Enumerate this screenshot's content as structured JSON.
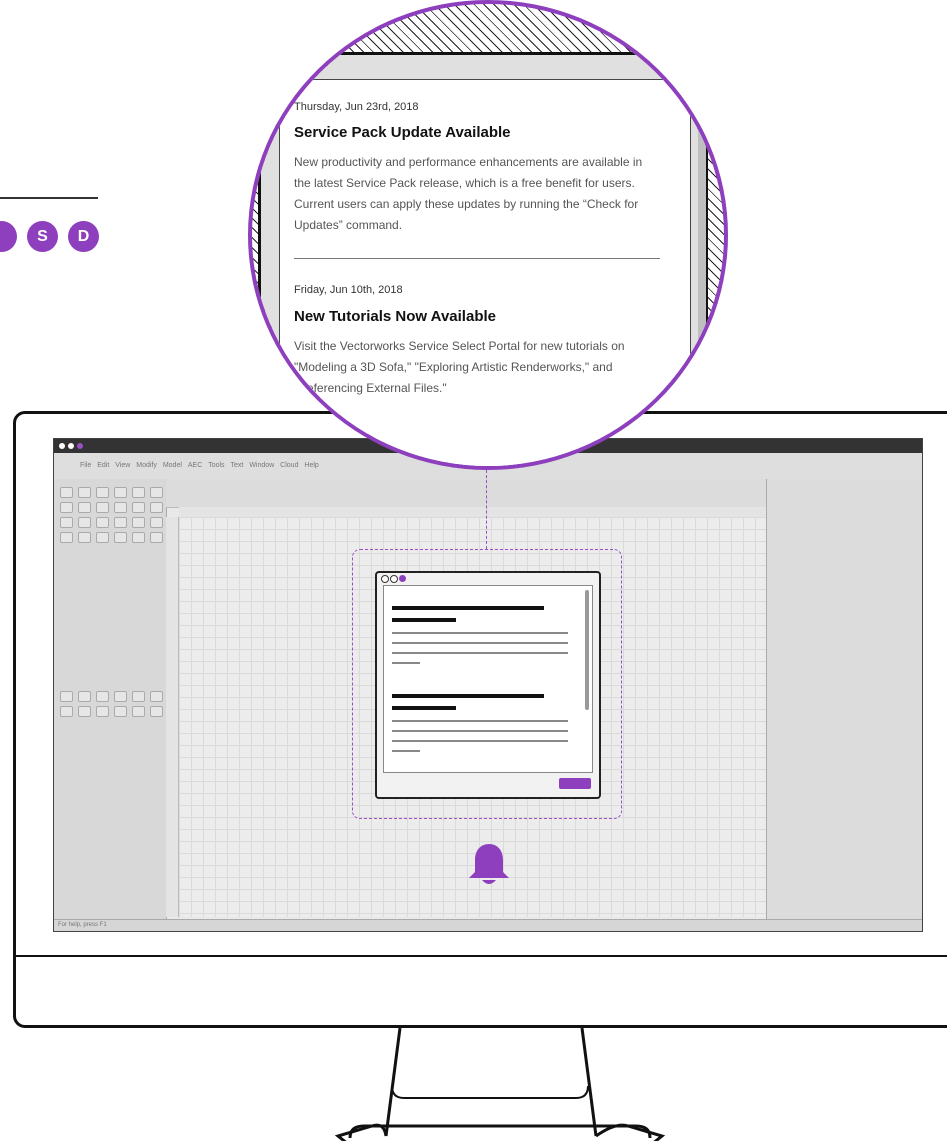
{
  "left_badges": [
    "S",
    "D"
  ],
  "colors": {
    "accent": "#8e3fbe",
    "outline": "#111111"
  },
  "app": {
    "menu": [
      "File",
      "Edit",
      "View",
      "Modify",
      "Model",
      "AEC",
      "Tools",
      "Text",
      "Window",
      "Cloud",
      "Help"
    ],
    "status_text": "For help, press F1"
  },
  "popup": {
    "window_dots": [
      "empty",
      "empty",
      "purple"
    ],
    "items": [
      {
        "date": "Thursday, Jun 23rd, 2018",
        "title": "Service Pack Update Available",
        "body": "New productivity and performance enhancements are available in the latest Service Pack release, which is a free benefit for users. Current users can apply these updates by running the “Check for Updates” command."
      },
      {
        "date": "Friday, Jun 10th, 2018",
        "title": "New Tutorials Now Available",
        "body": "Visit the Vectorworks Service Select Portal for new tutorials on \"Modeling a 3D Sofa,\" \"Exploring Artistic Renderworks,\" and \"Referencing External Files.\""
      }
    ]
  },
  "icons": {
    "notification": "bell-icon"
  }
}
